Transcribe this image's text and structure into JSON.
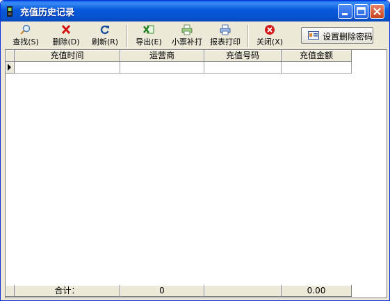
{
  "window": {
    "title": "充值历史记录"
  },
  "toolbar": {
    "buttons": [
      {
        "label": "查找(S)",
        "icon": "search-icon"
      },
      {
        "label": "删除(D)",
        "icon": "delete-icon"
      },
      {
        "label": "刷新(R)",
        "icon": "refresh-icon"
      },
      {
        "label": "导出(E)",
        "icon": "excel-export-icon"
      },
      {
        "label": "小票补打",
        "icon": "receipt-printer-icon"
      },
      {
        "label": "报表打印",
        "icon": "report-printer-icon"
      },
      {
        "label": "关闭(X)",
        "icon": "close-circle-icon"
      }
    ],
    "set_password_label": "设置删除密码",
    "set_password_icon": "id-card-icon"
  },
  "grid": {
    "columns": [
      "充值时间",
      "运营商",
      "充值号码",
      "充值金额"
    ],
    "rows": [
      [
        "",
        "",
        "",
        ""
      ]
    ],
    "footer": {
      "label": "合计：",
      "values": [
        "0",
        "",
        "0.00"
      ]
    }
  },
  "colors": {
    "titlebar": "#0758dc",
    "window_bg": "#ece9d8",
    "grid_bg": "#ffffff"
  }
}
